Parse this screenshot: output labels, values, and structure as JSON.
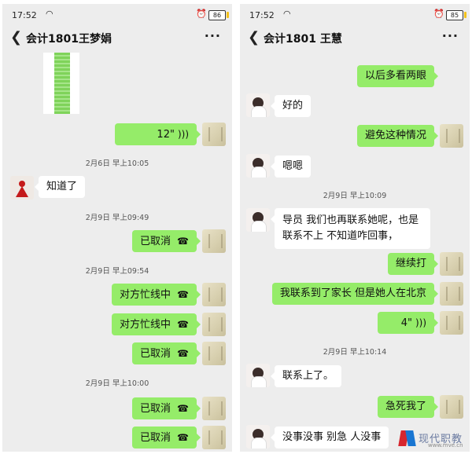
{
  "left": {
    "status": {
      "time": "17:52",
      "battery": "86"
    },
    "title": "会计1801王梦娟",
    "messages": {
      "m1_voice": "12\"",
      "ts1": "2月6日 早上10:05",
      "m2": "知道了",
      "ts2": "2月9日 早上09:49",
      "m3": "已取消",
      "ts3": "2月9日 早上09:54",
      "m4": "对方忙线中",
      "m5": "对方忙线中",
      "m6": "已取消",
      "ts4": "2月9日 早上10:00",
      "m7": "已取消",
      "m8": "已取消"
    }
  },
  "right": {
    "status": {
      "time": "17:52",
      "battery": "85"
    },
    "title": "会计1801 王慧",
    "messages": {
      "r1": "以后多看两眼",
      "r2": "好的",
      "r3": "避免这种情况",
      "r4": "嗯嗯",
      "ts1": "2月9日 早上10:09",
      "r5": "导员 我们也再联系她呢，也是联系不上 不知道咋回事，",
      "r6": "继续打",
      "r7": "我联系到了家长 但是她人在北京",
      "r8_voice": "4\"",
      "ts2": "2月9日 早上10:14",
      "r9": "联系上了。",
      "r10": "急死我了",
      "r11": "没事没事 别急 人没事"
    }
  },
  "icons": {
    "wifi": "wifi-icon",
    "alarm": "alarm-icon",
    "battery": "battery-icon",
    "back": "back-arrow-icon",
    "more": "more-icon",
    "call": "phone-icon",
    "voice": "voice-icon"
  },
  "watermark": {
    "text": "现代职教",
    "url": "www.mve.cn"
  }
}
